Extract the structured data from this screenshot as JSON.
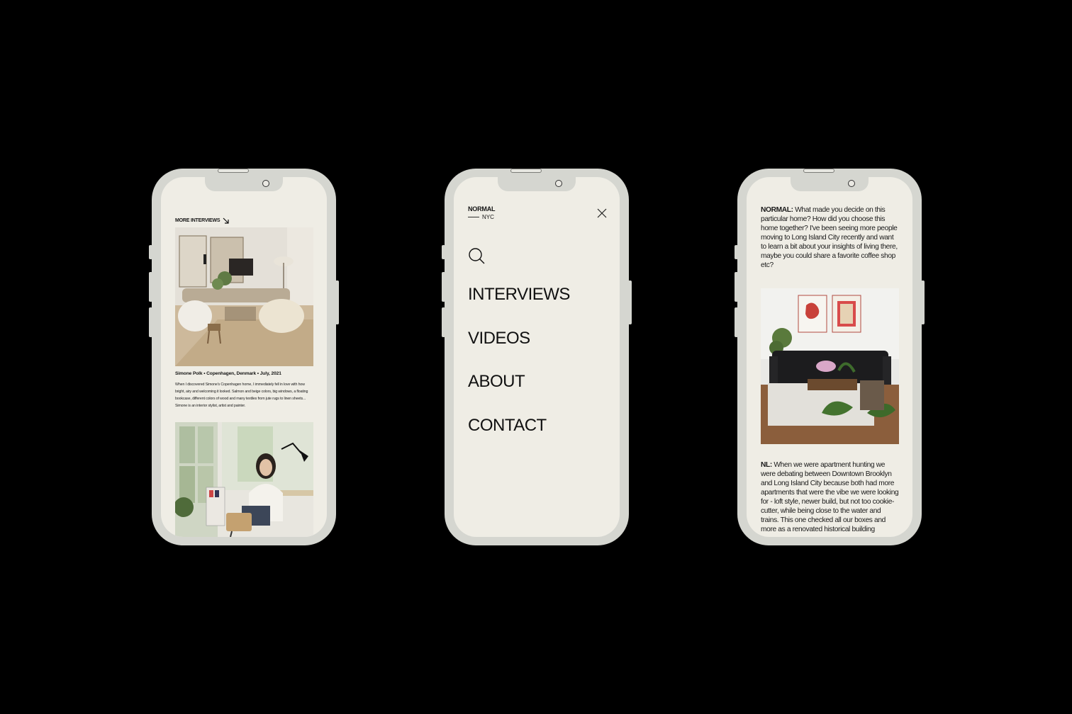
{
  "phone1": {
    "more_interviews": "MORE INTERVIEWS",
    "caption": "Simone Polk • Copenhagen, Denmark • July, 2021",
    "description": "When I discovered Simone's Copenhagen home, I immediately fell in love with how bright, airy and welcoming it looked. Salmon and beige colors, big windows, a floating bookcase, different colors of wood and many textiles from jute rugs to linen sheets... Simone is an interior stylist, artist and painter."
  },
  "phone2": {
    "brand": "NORMAL",
    "city": "NYC",
    "nav": [
      "INTERVIEWS",
      "VIDEOS",
      "ABOUT",
      "CONTACT"
    ]
  },
  "phone3": {
    "q_label": "NORMAL:",
    "q_text": " What made you decide on this particular home? How did you choose this home together? I've been seeing more people moving to Long Island City recently and want to learn a bit about your insights of living there, maybe you could share a favorite coffee shop etc?",
    "a_label": "NL:",
    "a_text": " When we were apartment hunting we were debating between Downtown Brooklyn and Long Island City because both had more apartments that were the vibe we were looking for - loft style, newer build, but not too cookie-cutter, while being close to the water and trains. This one checked all our boxes and more as a renovated historical building"
  },
  "icons": {
    "arrow": "arrow-down-right-icon",
    "close": "close-icon",
    "search": "search-icon"
  },
  "colors": {
    "background": "#000000",
    "phone_frame": "#d5d6d0",
    "screen": "#efede5",
    "text": "#151515"
  }
}
